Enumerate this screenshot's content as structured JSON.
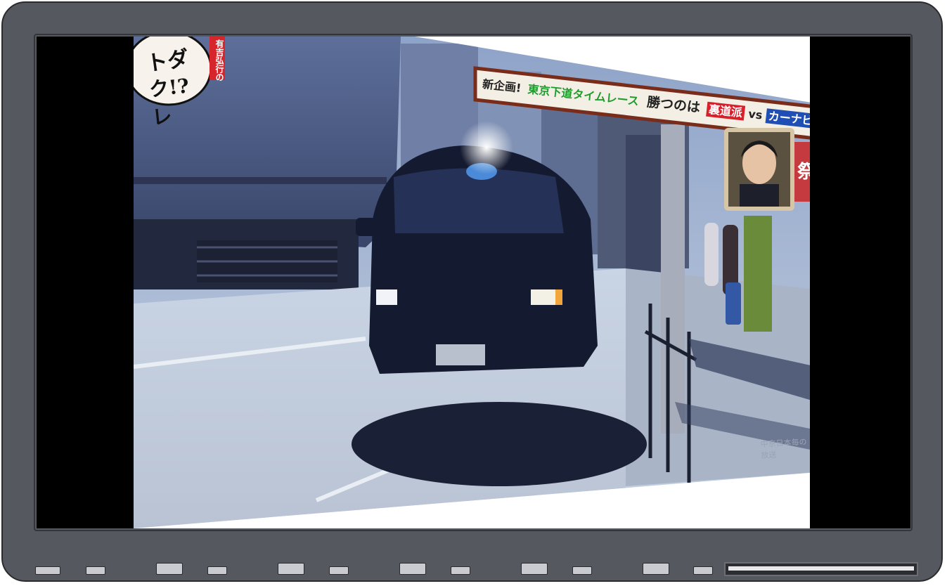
{
  "show": {
    "logo_line1": "トダ",
    "logo_line2": "ク!?レ",
    "logo_tag": "有吉弘行の"
  },
  "caption": {
    "prefix": "新企画!",
    "title": "東京下道タイムレース",
    "middle": "勝つのは",
    "team_a": "裏道派",
    "vs": "vs",
    "team_b": "カーナビ派"
  },
  "side_sign": "祭",
  "watermark": "中京日本毎の放送",
  "colors": {
    "bezel": "#55585e",
    "screen_bg": "#000000",
    "caption_green": "#1f9c2e",
    "team_a_red": "#d9202a",
    "team_b_blue": "#1f4fb5"
  }
}
